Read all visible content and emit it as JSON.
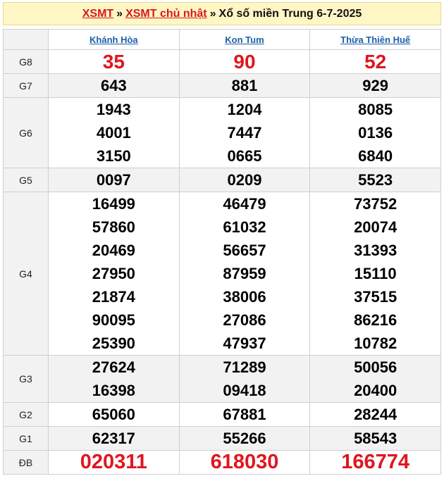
{
  "header": {
    "link1": "XSMT",
    "link2": "XSMT chủ nhật",
    "separator": "»",
    "text": "Xổ số miền Trung 6-7-2025"
  },
  "provinces": [
    "Khánh Hòa",
    "Kon Tum",
    "Thừa Thiên Huế"
  ],
  "colors": {
    "accent": "#e0161e",
    "header_bg": "#fef6c4",
    "link_blue": "#1a5fa8",
    "shade": "#f2f2f2"
  },
  "prizes": [
    {
      "label": "G8",
      "values": [
        [
          "35"
        ],
        [
          "90"
        ],
        [
          "52"
        ]
      ]
    },
    {
      "label": "G7",
      "values": [
        [
          "643"
        ],
        [
          "881"
        ],
        [
          "929"
        ]
      ]
    },
    {
      "label": "G6",
      "values": [
        [
          "1943",
          "4001",
          "3150"
        ],
        [
          "1204",
          "7447",
          "0665"
        ],
        [
          "8085",
          "0136",
          "6840"
        ]
      ]
    },
    {
      "label": "G5",
      "values": [
        [
          "0097"
        ],
        [
          "0209"
        ],
        [
          "5523"
        ]
      ]
    },
    {
      "label": "G4",
      "values": [
        [
          "16499",
          "57860",
          "20469",
          "27950",
          "21874",
          "90095",
          "25390"
        ],
        [
          "46479",
          "61032",
          "56657",
          "87959",
          "38006",
          "27086",
          "47937"
        ],
        [
          "73752",
          "20074",
          "31393",
          "15110",
          "37515",
          "86216",
          "10782"
        ]
      ]
    },
    {
      "label": "G3",
      "values": [
        [
          "27624",
          "16398"
        ],
        [
          "71289",
          "09418"
        ],
        [
          "50056",
          "20400"
        ]
      ]
    },
    {
      "label": "G2",
      "values": [
        [
          "65060"
        ],
        [
          "67881"
        ],
        [
          "28244"
        ]
      ]
    },
    {
      "label": "G1",
      "values": [
        [
          "62317"
        ],
        [
          "55266"
        ],
        [
          "58543"
        ]
      ]
    },
    {
      "label": "ĐB",
      "values": [
        [
          "020311"
        ],
        [
          "618030"
        ],
        [
          "166774"
        ]
      ]
    }
  ]
}
